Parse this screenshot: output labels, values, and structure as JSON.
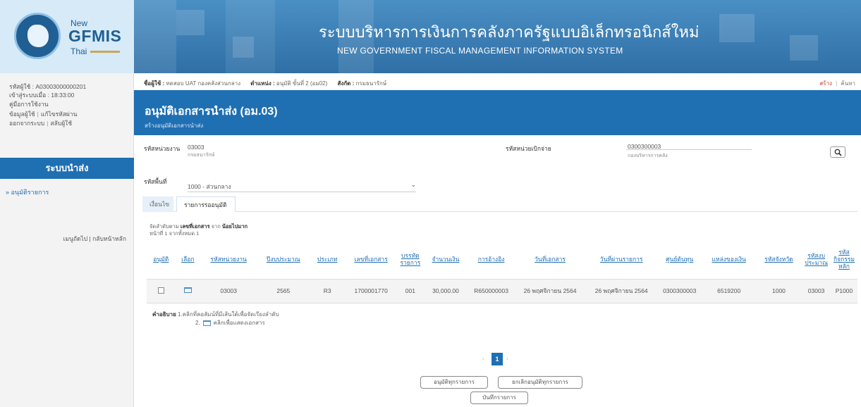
{
  "header": {
    "logo": {
      "new": "New",
      "gfmis": "GFMIS",
      "thai": "Thai"
    },
    "title_th": "ระบบบริหารการเงินการคลังภาครัฐแบบอิเล็กทรอนิกส์ใหม่",
    "title_en": "NEW GOVERNMENT FISCAL MANAGEMENT INFORMATION SYSTEM"
  },
  "sidebar": {
    "user_code": "รหัสผู้ใช้ : A03003000000201",
    "login_time": "เข้าสู่ระบบเมื่อ : 18:33:00",
    "manual": "คู่มือการใช้งาน",
    "user_info": "ข้อมูลผู้ใช้",
    "change_password": "แก้ไขรหัสผ่าน",
    "logout": "ออกจากระบบ",
    "switch_user": "สลับผู้ใช้",
    "menu_title": "ระบบนำส่ง",
    "menu_item": "» อนุมัติรายการ",
    "back_link": "เมนูถัดไป | กลับหน้าหลัก"
  },
  "userbar": {
    "user_label": "ชื่อผู้ใช้ :",
    "user_value": "ทดสอบ UAT กองคลังส่วนกลาง",
    "position_label": "ตำแหน่ง :",
    "position_value": "อนุมัติ ขั้นที่ 2 (อม02)",
    "agency_label": "สังกัด :",
    "agency_value": "กรมธนารักษ์",
    "create": "สร้าง",
    "search": "ค้นหา"
  },
  "page": {
    "title": "อนุมัติเอกสารนำส่ง (อม.03)",
    "subtitle": "สร้างอนุมัติเอกสารนำส่ง"
  },
  "form": {
    "unit_label": "รหัสหน่วยงาน",
    "unit_value": "03003",
    "unit_name": "กรมธนารักษ์",
    "disb_label": "รหัสหน่วยเบิกจ่าย",
    "disb_value": "0300300003",
    "disb_name": "กองบริหารการคลัง",
    "area_label": "รหัสพื้นที่",
    "area_value": "1000 - ส่วนกลาง"
  },
  "tabs": [
    {
      "label": "เงื่อนไข"
    },
    {
      "label": "รายการรออนุมัติ"
    }
  ],
  "list": {
    "sort_prefix": "จัดลำดับตาม",
    "sort_field": "เลขที่เอกสาร",
    "sort_mid": "จาก",
    "sort_order": "น้อยไปมาก",
    "page_info": "หน้าที่ 1 จากทั้งหมด 1",
    "columns": [
      "อนุมัติ",
      "เลือก",
      "รหัสหน่วยงาน",
      "ปีงบประมาณ",
      "ประเภท",
      "เลขที่เอกสาร",
      "บรรทัดรายการ",
      "จำนวนเงิน",
      "การอ้างอิง",
      "วันที่เอกสาร",
      "วันที่ผ่านรายการ",
      "ศูนย์ต้นทุน",
      "แหล่งของเงิน",
      "รหัสจังหวัด",
      "รหัสงบประมาณ",
      "รหัสกิจกรรมหลัก"
    ],
    "rows": [
      {
        "unit": "03003",
        "year": "2565",
        "type": "R3",
        "doc_no": "1700001770",
        "line": "001",
        "amount": "30,000.00",
        "ref": "R650000003",
        "doc_date": "26 พฤศจิกายน 2564",
        "post_date": "26 พฤศจิกายน 2564",
        "cost_center": "0300300003",
        "fund": "6519200",
        "province": "1000",
        "budget": "03003",
        "activity": "P1000"
      }
    ]
  },
  "explain": {
    "label": "คำอธิบาย",
    "line1": "1.คลิกที่คอลัมน์ที่มีเส้นใต้เพื่อจัดเรียงลำดับ",
    "line2_prefix": "2.",
    "line2": "คลิกเพื่อแสดงเอกสาร"
  },
  "pager": {
    "current": "1"
  },
  "buttons": {
    "approve_all": "อนุมัติทุกรายการ",
    "cancel_all": "ยกเลิกอนุมัติทุกรายการ",
    "save": "บันทึกรายการ"
  }
}
